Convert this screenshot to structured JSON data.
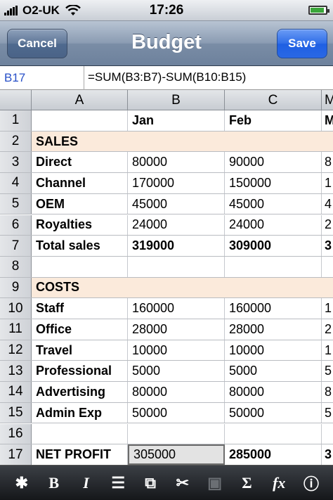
{
  "status_bar": {
    "carrier": "O2-UK",
    "time": "17:26"
  },
  "nav": {
    "cancel_label": "Cancel",
    "title": "Budget",
    "save_label": "Save"
  },
  "formula_bar": {
    "cell_ref": "B17",
    "formula": "=SUM(B3:B7)-SUM(B10:B15)"
  },
  "sheet": {
    "columns": [
      "A",
      "B",
      "C",
      "M"
    ],
    "rows": [
      {
        "num": "1",
        "a": "",
        "b": "Jan",
        "c": "Feb",
        "d": "M",
        "bold": true
      },
      {
        "num": "2",
        "a": "SALES",
        "b": "",
        "c": "",
        "d": "",
        "section": true
      },
      {
        "num": "3",
        "a": "Direct",
        "b": "80000",
        "c": "90000",
        "d": "8"
      },
      {
        "num": "4",
        "a": "Channel",
        "b": "170000",
        "c": "150000",
        "d": "1"
      },
      {
        "num": "5",
        "a": "OEM",
        "b": "45000",
        "c": "45000",
        "d": "4"
      },
      {
        "num": "6",
        "a": "Royalties",
        "b": "24000",
        "c": "24000",
        "d": "2"
      },
      {
        "num": "7",
        "a": "Total sales",
        "b": "319000",
        "c": "309000",
        "d": "3",
        "bold": true
      },
      {
        "num": "8",
        "a": "",
        "b": "",
        "c": "",
        "d": ""
      },
      {
        "num": "9",
        "a": "COSTS",
        "b": "",
        "c": "",
        "d": "",
        "section": true
      },
      {
        "num": "10",
        "a": "Staff",
        "b": "160000",
        "c": "160000",
        "d": "1"
      },
      {
        "num": "11",
        "a": "Office",
        "b": "28000",
        "c": "28000",
        "d": "2"
      },
      {
        "num": "12",
        "a": "Travel",
        "b": "10000",
        "c": "10000",
        "d": "1"
      },
      {
        "num": "13",
        "a": "Professional",
        "b": "5000",
        "c": "5000",
        "d": "5"
      },
      {
        "num": "14",
        "a": "Advertising",
        "b": "80000",
        "c": "80000",
        "d": "8"
      },
      {
        "num": "15",
        "a": "Admin Exp",
        "b": "50000",
        "c": "50000",
        "d": "5"
      },
      {
        "num": "16",
        "a": "",
        "b": "",
        "c": "",
        "d": ""
      },
      {
        "num": "17",
        "a": "NET PROFIT",
        "b": "305000",
        "c": "285000",
        "d": "3",
        "net": true
      }
    ]
  },
  "toolbar": {
    "tools": [
      {
        "name": "settings-icon",
        "glyph": "✱"
      },
      {
        "name": "bold-icon",
        "glyph": "B"
      },
      {
        "name": "italic-icon",
        "glyph": "I"
      },
      {
        "name": "align-icon",
        "glyph": "☰"
      },
      {
        "name": "copy-icon",
        "glyph": "⧉"
      },
      {
        "name": "cut-icon",
        "glyph": "✂"
      },
      {
        "name": "paste-icon",
        "glyph": "▣"
      },
      {
        "name": "sum-icon",
        "glyph": "Σ"
      },
      {
        "name": "function-icon",
        "glyph": "fx"
      },
      {
        "name": "info-icon",
        "glyph": "ⓘ"
      }
    ]
  },
  "colors": {
    "section_bg": "#fbeadb",
    "cell_ref": "#2850c8",
    "save_button": "#2a68e5"
  }
}
